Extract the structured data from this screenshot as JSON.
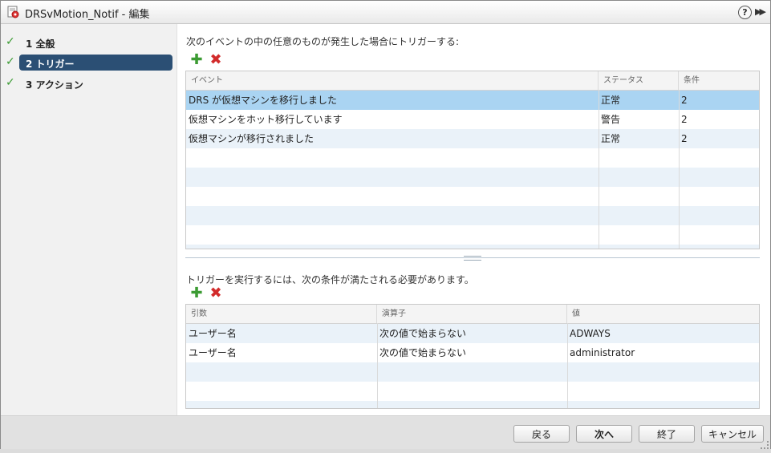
{
  "window": {
    "title": "DRSvMotion_Notif - 編集",
    "help_glyph": "?",
    "expand_glyph": "▶▶"
  },
  "steps": [
    {
      "label": "1 全般",
      "state": "done"
    },
    {
      "label": "2 トリガー",
      "state": "active"
    },
    {
      "label": "3 アクション",
      "state": "done"
    }
  ],
  "triggers": {
    "prompt": "次のイベントの中の任意のものが発生した場合にトリガーする:",
    "columns": [
      "イベント",
      "ステータス",
      "条件"
    ],
    "rows": [
      {
        "event": "DRS が仮想マシンを移行しました",
        "status": "正常",
        "conditions": "2",
        "selected": true
      },
      {
        "event": "仮想マシンをホット移行しています",
        "status": "警告",
        "conditions": "2",
        "selected": false
      },
      {
        "event": "仮想マシンが移行されました",
        "status": "正常",
        "conditions": "2",
        "selected": false
      }
    ]
  },
  "conditions": {
    "prompt": "トリガーを実行するには、次の条件が満たされる必要があります。",
    "columns": [
      "引数",
      "演算子",
      "値"
    ],
    "rows": [
      {
        "argument": "ユーザー名",
        "operator": "次の値で始まらない",
        "value": "ADWAYS"
      },
      {
        "argument": "ユーザー名",
        "operator": "次の値で始まらない",
        "value": "administrator"
      }
    ]
  },
  "footer": {
    "back": "戻る",
    "next": "次へ",
    "finish": "終了",
    "cancel": "キャンセル"
  },
  "colors": {
    "accent_selected_step": "#2b4f74",
    "selected_row": "#aad4f2",
    "alt_row": "#eaf2f9",
    "check": "#3a9b32",
    "add": "#3c9b33",
    "delete": "#d22b2b"
  },
  "icons": {
    "check": "check-icon",
    "add": "add-icon",
    "delete": "delete-icon"
  }
}
